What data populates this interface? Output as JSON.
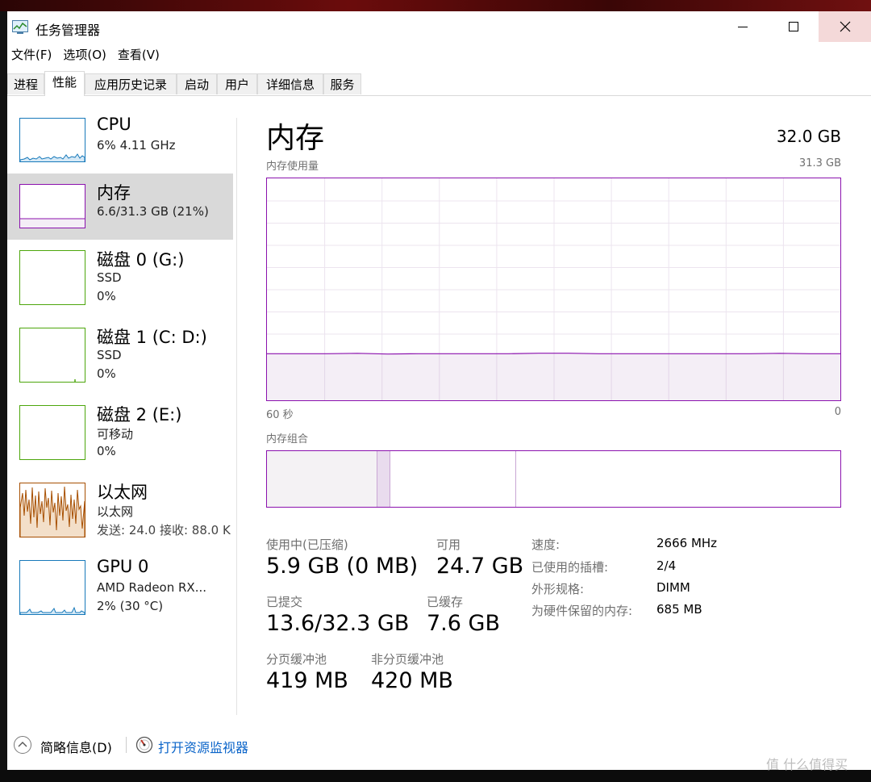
{
  "window": {
    "title": "任务管理器"
  },
  "menu": [
    "文件(F)",
    "选项(O)",
    "查看(V)"
  ],
  "tabs": [
    {
      "label": "进程"
    },
    {
      "label": "性能",
      "active": true
    },
    {
      "label": "应用历史记录"
    },
    {
      "label": "启动"
    },
    {
      "label": "用户"
    },
    {
      "label": "详细信息"
    },
    {
      "label": "服务"
    }
  ],
  "sidebar": [
    {
      "title": "CPU",
      "lines": [
        "6%  4.11 GHz"
      ],
      "color": "#1779ba"
    },
    {
      "title": "内存",
      "lines": [
        "6.6/31.3 GB (21%)"
      ],
      "color": "#8b12ae"
    },
    {
      "title": "磁盘 0 (G:)",
      "lines": [
        "SSD",
        "0%"
      ],
      "color": "#4da60c"
    },
    {
      "title": "磁盘 1 (C: D:)",
      "lines": [
        "SSD",
        "0%"
      ],
      "color": "#4da60c"
    },
    {
      "title": "磁盘 2 (E:)",
      "lines": [
        "可移动",
        "0%"
      ],
      "color": "#4da60c"
    },
    {
      "title": "以太网",
      "lines": [
        "以太网",
        "发送: 24.0  接收: 88.0 K"
      ],
      "color": "#a74f01"
    },
    {
      "title": "GPU 0",
      "lines": [
        "AMD Radeon RX...",
        "2%  (30 °C)"
      ],
      "color": "#1779ba"
    }
  ],
  "memory": {
    "title": "内存",
    "total": "32.0 GB",
    "usage_label": "内存使用量",
    "usage_max": "31.3 GB",
    "time_left": "60 秒",
    "time_right": "0",
    "usage_fraction": 0.21,
    "composition_label": "内存组合",
    "stats": {
      "in_use_label": "使用中(已压缩)",
      "in_use": "5.9 GB (0 MB)",
      "available_label": "可用",
      "available": "24.7 GB",
      "committed_label": "已提交",
      "committed": "13.6/32.3 GB",
      "cached_label": "已缓存",
      "cached": "7.6 GB",
      "paged_label": "分页缓冲池",
      "paged": "419 MB",
      "nonpaged_label": "非分页缓冲池",
      "nonpaged": "420 MB"
    },
    "details": [
      {
        "key": "速度:",
        "value": "2666 MHz"
      },
      {
        "key": "已使用的插槽:",
        "value": "2/4"
      },
      {
        "key": "外形规格:",
        "value": "DIMM"
      },
      {
        "key": "为硬件保留的内存:",
        "value": "685 MB"
      }
    ]
  },
  "footer": {
    "brief": "简略信息(D)",
    "monitor": "打开资源监视器"
  },
  "watermark": "值 什么值得买",
  "colors": {
    "accent": "#8b12ae",
    "link": "#0a64c9"
  }
}
